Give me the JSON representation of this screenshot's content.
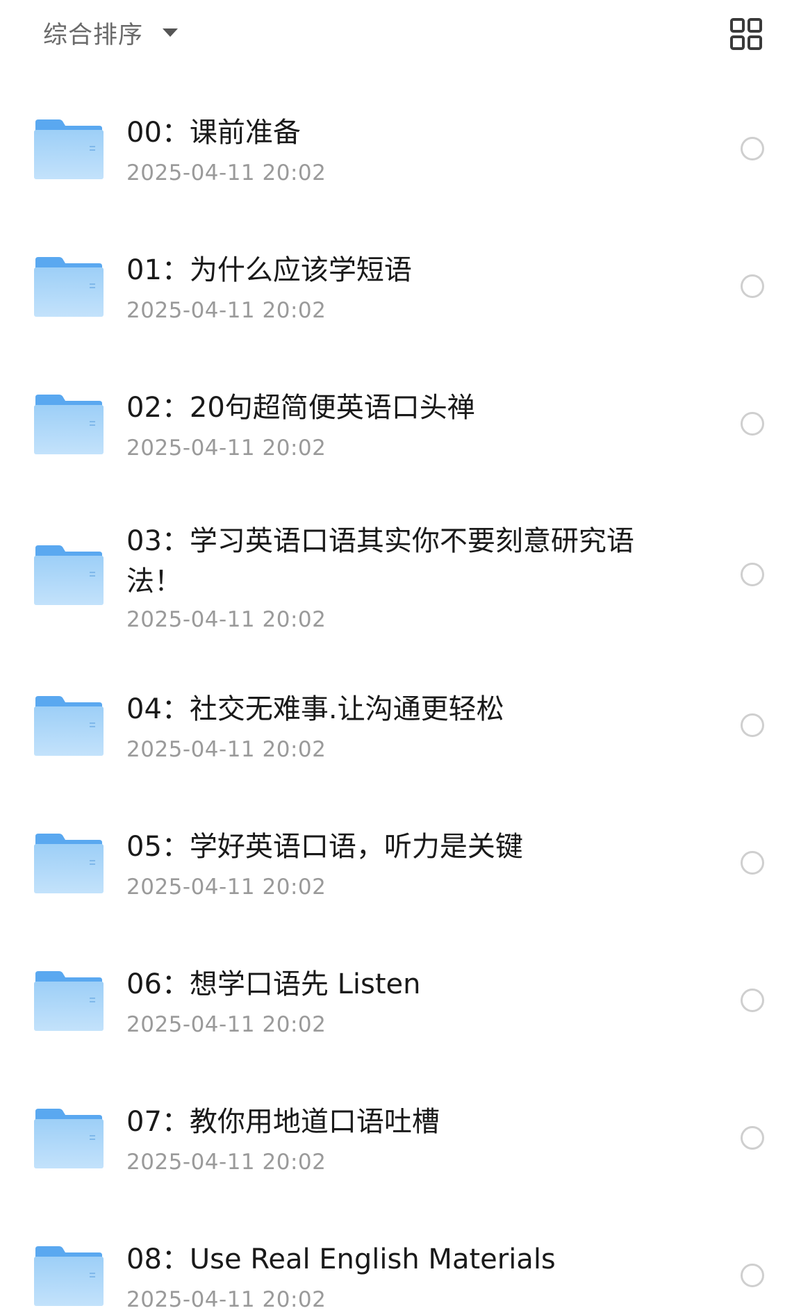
{
  "header": {
    "sort_label": "综合排序",
    "sort_caret_icon": "caret-down-icon",
    "view_toggle_icon": "grid-view-icon"
  },
  "colors": {
    "folder_top": "#5aa8f0",
    "folder_body_light": "#bfe0fb",
    "folder_body_dark": "#8cc6f6",
    "title_text": "#1a1a1a",
    "date_text": "#9a9a9a",
    "radio_border": "#cfcfcf",
    "header_text": "#6a6a6a"
  },
  "items": [
    {
      "title": "00：课前准备",
      "date": "2025-04-11 20:02",
      "icon": "folder-icon"
    },
    {
      "title": "01：为什么应该学短语",
      "date": "2025-04-11 20:02",
      "icon": "folder-icon"
    },
    {
      "title": "02：20句超简便英语口头禅",
      "date": "2025-04-11 20:02",
      "icon": "folder-icon"
    },
    {
      "title": "03：学习英语口语其实你不要刻意研究语法！",
      "date": "2025-04-11 20:02",
      "icon": "folder-icon"
    },
    {
      "title": "04：社交无难事.让沟通更轻松",
      "date": "2025-04-11 20:02",
      "icon": "folder-icon"
    },
    {
      "title": "05：学好英语口语，听力是关键",
      "date": "2025-04-11 20:02",
      "icon": "folder-icon"
    },
    {
      "title": "06：想学口语先 Listen",
      "date": "2025-04-11 20:02",
      "icon": "folder-icon"
    },
    {
      "title": "07：教你用地道口语吐槽",
      "date": "2025-04-11 20:02",
      "icon": "folder-icon"
    },
    {
      "title": "08：Use Real English Materials",
      "date": "2025-04-11 20:02",
      "icon": "folder-icon"
    }
  ]
}
